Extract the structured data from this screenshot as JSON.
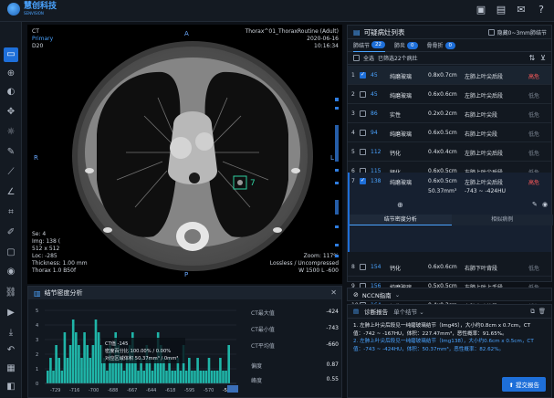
{
  "app": {
    "logo_text": "慧创科技",
    "logo_sub": "SENVISION"
  },
  "top_icons": [
    "layers-icon",
    "clipboard-icon",
    "mail-icon",
    "question-icon"
  ],
  "viewer": {
    "tl": [
      "CT",
      "Primary",
      "D20"
    ],
    "tr": [
      "Thorax^01_ThoraxRoutine (Adult)",
      "2020-06-16",
      "10:16:34"
    ],
    "bl": [
      "Se: 4",
      "Img: 138 (",
      "512 x 512",
      "Loc: -285",
      "Thickness: 1.00 mm",
      "Thorax 1.0 B50f"
    ],
    "br": [
      "Zoom: 117%",
      "Lossless / Uncompressed",
      "W 1500 L -600"
    ],
    "orient": {
      "top": "A",
      "bottom": "P",
      "left": "R",
      "right": "L"
    },
    "roi_label": "7"
  },
  "density": {
    "title": "结节密度分析",
    "xticks": [
      "-729",
      "-716",
      "-700",
      "-688",
      "-667",
      "-644",
      "-618",
      "-595",
      "-570",
      "-545"
    ],
    "yticks": [
      "5",
      "4",
      "3",
      "2",
      "1",
      "0"
    ],
    "tooltip": [
      "CT值 -145",
      "密度百分比 100.00% / 0.00%",
      "对应区域体积 50.37mm³ / 0mm³"
    ],
    "stats": [
      {
        "k": "CT最大值",
        "v": "-424"
      },
      {
        "k": "CT最小值",
        "v": "-743"
      },
      {
        "k": "CT平均值",
        "v": "-660"
      },
      {
        "k": "偏度",
        "v": "0.87"
      },
      {
        "k": "峰度",
        "v": "0.55"
      }
    ]
  },
  "nodules": {
    "title": "可疑病灶列表",
    "hide_tiny": "隐藏0~3mm肺结节",
    "tabs": [
      {
        "label": "肺结节",
        "count": "22"
      },
      {
        "label": "肺炎",
        "count": "0"
      },
      {
        "label": "骨骨折",
        "count": "0"
      }
    ],
    "select_all": "全选",
    "selected_text": "已筛选22个病灶",
    "rows": [
      {
        "idx": "1",
        "num": "45",
        "type": "纯磨玻璃",
        "size": "0.8x0.7cm",
        "loc": "左肺上叶尖后段",
        "risk": "高危",
        "checked": true
      },
      {
        "idx": "2",
        "num": "45",
        "type": "纯磨玻璃",
        "size": "0.6x0.6cm",
        "loc": "左肺上叶尖后段",
        "risk": "低危",
        "checked": false
      },
      {
        "idx": "3",
        "num": "86",
        "type": "实性",
        "size": "0.2x0.2cm",
        "loc": "右肺上叶尖段",
        "risk": "低危",
        "checked": false
      },
      {
        "idx": "4",
        "num": "94",
        "type": "纯磨玻璃",
        "size": "0.6x0.5cm",
        "loc": "右肺上叶尖段",
        "risk": "低危",
        "checked": false
      },
      {
        "idx": "5",
        "num": "112",
        "type": "钙化",
        "size": "0.4x0.4cm",
        "loc": "左肺上叶尖后段",
        "risk": "低危",
        "checked": false
      },
      {
        "idx": "6",
        "num": "115",
        "type": "钙化",
        "size": "0.6x0.5cm",
        "loc": "左肺上叶尖后段",
        "risk": "低危",
        "checked": false
      },
      {
        "idx": "8",
        "num": "154",
        "type": "钙化",
        "size": "0.6x0.6cm",
        "loc": "右肺下叶背段",
        "risk": "低危",
        "checked": false
      },
      {
        "idx": "9",
        "num": "156",
        "type": "纯磨玻璃",
        "size": "0.5x0.5cm",
        "loc": "左肺上叶上舌段",
        "risk": "低危",
        "checked": false
      },
      {
        "idx": "10",
        "num": "164",
        "type": "钙化",
        "size": "0.4x0.3cm",
        "loc": "右肺中叶外段",
        "risk": "低危",
        "checked": false
      }
    ],
    "expanded": {
      "idx": "7",
      "num": "138",
      "type": "纯磨玻璃",
      "size": "0.6x0.5cm",
      "loc": "左肺上叶尖后段",
      "risk": "高危",
      "volume": "50.37mm³",
      "ct_range": "-743 ~ -424HU",
      "subtab1": "结节密度分析",
      "subtab2": "相似病例"
    }
  },
  "nccn": {
    "label": "NCCN指南"
  },
  "report": {
    "title": "诊断报告",
    "mode": "单个结节",
    "line1": "1. 左肺上叶尖后段见一纯磨玻璃结节（Img45），大小约0.8cm x 0.7cm，CT值：-742 ~ -167HU，体积：227.47mm³，恶性概率：91.65%。",
    "line2": "2. 左肺上叶尖后段见一纯磨玻璃结节（Img138），大小约0.6cm x 0.5cm，CT值：-743 ~ -424HU，体积：50.37mm³，恶性概率：82.62%。",
    "submit": "提交报告"
  }
}
